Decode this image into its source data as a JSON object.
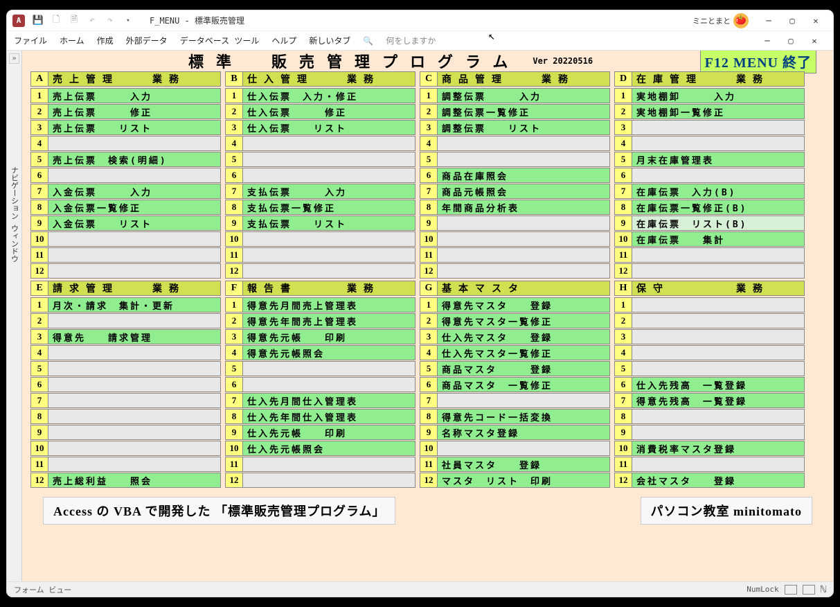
{
  "window": {
    "title": "F_MENU - 標準販売管理",
    "user": "ミニとまと"
  },
  "ribbon": {
    "file": "ファイル",
    "home": "ホーム",
    "create": "作成",
    "ext": "外部データ",
    "db": "データベース ツール",
    "help": "ヘルプ",
    "new": "新しいタブ",
    "tell": "何をしますか"
  },
  "nav": {
    "label": "ナビゲーション ウィンドウ"
  },
  "header": {
    "title": "標準　販売管理プログラム",
    "ver": "Ver 20220516",
    "f12": "F12 MENU 終了"
  },
  "sections": {
    "A": {
      "key": "A",
      "title": "売上管理　　業務",
      "items": [
        {
          "n": "1",
          "t": "売上伝票　　　入力",
          "c": "g"
        },
        {
          "n": "2",
          "t": "売上伝票　　　修正",
          "c": "g"
        },
        {
          "n": "3",
          "t": "売上伝票　　リスト",
          "c": "g"
        },
        {
          "n": "4",
          "t": "",
          "c": "e"
        },
        {
          "n": "5",
          "t": "売上伝票　検索(明細)",
          "c": "g"
        },
        {
          "n": "6",
          "t": "",
          "c": "e"
        },
        {
          "n": "7",
          "t": "入金伝票　　　入力",
          "c": "g"
        },
        {
          "n": "8",
          "t": "入金伝票一覧修正",
          "c": "g"
        },
        {
          "n": "9",
          "t": "入金伝票　　リスト",
          "c": "g"
        },
        {
          "n": "10",
          "t": "",
          "c": "e"
        },
        {
          "n": "11",
          "t": "",
          "c": "e"
        },
        {
          "n": "12",
          "t": "",
          "c": "e"
        }
      ]
    },
    "B": {
      "key": "B",
      "title": "仕入管理　　業務",
      "items": [
        {
          "n": "1",
          "t": "仕入伝票　入力・修正",
          "c": "g"
        },
        {
          "n": "2",
          "t": "仕入伝票　　　修正",
          "c": "g"
        },
        {
          "n": "3",
          "t": "仕入伝票　　リスト",
          "c": "g"
        },
        {
          "n": "4",
          "t": "",
          "c": "e"
        },
        {
          "n": "5",
          "t": "",
          "c": "e"
        },
        {
          "n": "6",
          "t": "",
          "c": "e"
        },
        {
          "n": "7",
          "t": "支払伝票　　　入力",
          "c": "g"
        },
        {
          "n": "8",
          "t": "支払伝票一覧修正",
          "c": "g"
        },
        {
          "n": "9",
          "t": "支払伝票　　リスト",
          "c": "g"
        },
        {
          "n": "10",
          "t": "",
          "c": "e"
        },
        {
          "n": "11",
          "t": "",
          "c": "e"
        },
        {
          "n": "12",
          "t": "",
          "c": "e"
        }
      ]
    },
    "C": {
      "key": "C",
      "title": "商品管理　　業務",
      "items": [
        {
          "n": "1",
          "t": "調整伝票　　　入力",
          "c": "g"
        },
        {
          "n": "2",
          "t": "調整伝票一覧修正",
          "c": "g"
        },
        {
          "n": "3",
          "t": "調整伝票　　リスト",
          "c": "g"
        },
        {
          "n": "4",
          "t": "",
          "c": "e"
        },
        {
          "n": "5",
          "t": "",
          "c": "e"
        },
        {
          "n": "6",
          "t": "商品在庫照会",
          "c": "g"
        },
        {
          "n": "7",
          "t": "商品元帳照会",
          "c": "g"
        },
        {
          "n": "8",
          "t": "年間商品分析表",
          "c": "g"
        },
        {
          "n": "9",
          "t": "",
          "c": "e"
        },
        {
          "n": "10",
          "t": "",
          "c": "e"
        },
        {
          "n": "11",
          "t": "",
          "c": "e"
        },
        {
          "n": "12",
          "t": "",
          "c": "e"
        }
      ]
    },
    "D": {
      "key": "D",
      "title": "在庫管理　　業務",
      "items": [
        {
          "n": "1",
          "t": "実地棚卸　　　入力",
          "c": "g"
        },
        {
          "n": "2",
          "t": "実地棚卸一覧修正",
          "c": "g"
        },
        {
          "n": "3",
          "t": "",
          "c": "e"
        },
        {
          "n": "4",
          "t": "",
          "c": "e"
        },
        {
          "n": "5",
          "t": "月末在庫管理表",
          "c": "g"
        },
        {
          "n": "6",
          "t": "",
          "c": "e"
        },
        {
          "n": "7",
          "t": "在庫伝票　入力(B)",
          "c": "g"
        },
        {
          "n": "8",
          "t": "在庫伝票一覧修正(B)",
          "c": "g"
        },
        {
          "n": "9",
          "t": "在庫伝票　リスト(B)",
          "c": "w"
        },
        {
          "n": "10",
          "t": "在庫伝票　　集計",
          "c": "g"
        },
        {
          "n": "11",
          "t": "",
          "c": "e"
        },
        {
          "n": "12",
          "t": "",
          "c": "e"
        }
      ]
    },
    "E": {
      "key": "E",
      "title": "請求管理　　業務",
      "items": [
        {
          "n": "1",
          "t": "月次・請求　集計・更新",
          "c": "g"
        },
        {
          "n": "2",
          "t": "",
          "c": "e"
        },
        {
          "n": "3",
          "t": "得意先　　請求管理",
          "c": "g"
        },
        {
          "n": "4",
          "t": "",
          "c": "e"
        },
        {
          "n": "5",
          "t": "",
          "c": "e"
        },
        {
          "n": "6",
          "t": "",
          "c": "e"
        },
        {
          "n": "7",
          "t": "",
          "c": "e"
        },
        {
          "n": "8",
          "t": "",
          "c": "e"
        },
        {
          "n": "9",
          "t": "",
          "c": "e"
        },
        {
          "n": "10",
          "t": "",
          "c": "e"
        },
        {
          "n": "11",
          "t": "",
          "c": "e"
        },
        {
          "n": "12",
          "t": "売上総利益　　照会",
          "c": "g"
        }
      ]
    },
    "F": {
      "key": "F",
      "title": "報告書　　　業務",
      "items": [
        {
          "n": "1",
          "t": "得意先月間売上管理表",
          "c": "g"
        },
        {
          "n": "2",
          "t": "得意先年間売上管理表",
          "c": "g"
        },
        {
          "n": "3",
          "t": "得意先元帳　　印刷",
          "c": "g"
        },
        {
          "n": "4",
          "t": "得意先元帳照会",
          "c": "g"
        },
        {
          "n": "5",
          "t": "",
          "c": "e"
        },
        {
          "n": "6",
          "t": "",
          "c": "e"
        },
        {
          "n": "7",
          "t": "仕入先月間仕入管理表",
          "c": "g"
        },
        {
          "n": "8",
          "t": "仕入先年間仕入管理表",
          "c": "g"
        },
        {
          "n": "9",
          "t": "仕入先元帳　　印刷",
          "c": "g"
        },
        {
          "n": "10",
          "t": "仕入先元帳照会",
          "c": "g"
        },
        {
          "n": "11",
          "t": "",
          "c": "e"
        },
        {
          "n": "12",
          "t": "",
          "c": "e"
        }
      ]
    },
    "G": {
      "key": "G",
      "title": "基本マスタ",
      "items": [
        {
          "n": "1",
          "t": "得意先マスタ　　登録",
          "c": "g"
        },
        {
          "n": "2",
          "t": "得意先マスタ一覧修正",
          "c": "g"
        },
        {
          "n": "3",
          "t": "仕入先マスタ　　登録",
          "c": "g"
        },
        {
          "n": "4",
          "t": "仕入先マスタ一覧修正",
          "c": "g"
        },
        {
          "n": "5",
          "t": "商品マスタ　　　登録",
          "c": "g"
        },
        {
          "n": "6",
          "t": "商品マスタ　一覧修正",
          "c": "g"
        },
        {
          "n": "7",
          "t": "",
          "c": "e"
        },
        {
          "n": "8",
          "t": "得意先コード一括変換",
          "c": "g"
        },
        {
          "n": "9",
          "t": "名称マスタ登録",
          "c": "g"
        },
        {
          "n": "10",
          "t": "",
          "c": "e"
        },
        {
          "n": "11",
          "t": "社員マスタ　　登録",
          "c": "g"
        },
        {
          "n": "12",
          "t": "マスタ　リスト　印刷",
          "c": "g"
        }
      ]
    },
    "H": {
      "key": "H",
      "title": "保守　　　　業務",
      "items": [
        {
          "n": "1",
          "t": "",
          "c": "e"
        },
        {
          "n": "2",
          "t": "",
          "c": "e"
        },
        {
          "n": "3",
          "t": "",
          "c": "e"
        },
        {
          "n": "4",
          "t": "",
          "c": "e"
        },
        {
          "n": "5",
          "t": "",
          "c": "e"
        },
        {
          "n": "6",
          "t": "仕入先残高　一覧登録",
          "c": "g"
        },
        {
          "n": "7",
          "t": "得意先残高　一覧登録",
          "c": "g"
        },
        {
          "n": "8",
          "t": "",
          "c": "e"
        },
        {
          "n": "9",
          "t": "",
          "c": "e"
        },
        {
          "n": "10",
          "t": "消費税率マスタ登録",
          "c": "g"
        },
        {
          "n": "11",
          "t": "",
          "c": "e"
        },
        {
          "n": "12",
          "t": "会社マスタ　　登録",
          "c": "g"
        }
      ]
    }
  },
  "footer": {
    "left": "Access の VBA で開発した 「標準販売管理プログラム」",
    "right": "パソコン教室 minitomato"
  },
  "status": {
    "view": "フォーム ビュー",
    "numlock": "NumLock"
  }
}
